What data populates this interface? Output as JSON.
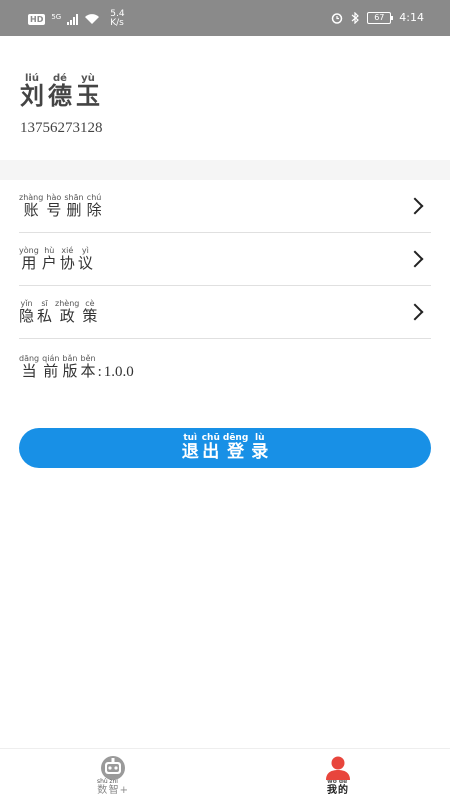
{
  "status_bar": {
    "hd": "HD",
    "network": "5G",
    "speed_value": "5.4",
    "speed_unit": "K/s",
    "battery": "67",
    "time": "4:14"
  },
  "profile": {
    "name": [
      {
        "hz": "刘",
        "py": "liú"
      },
      {
        "hz": "德",
        "py": "dé"
      },
      {
        "hz": "玉",
        "py": "yù"
      }
    ],
    "phone": "13756273128"
  },
  "menu": {
    "items": [
      {
        "chars": [
          {
            "hz": "账",
            "py": "zhàng"
          },
          {
            "hz": "号",
            "py": "hào"
          },
          {
            "hz": "删",
            "py": "shān"
          },
          {
            "hz": "除",
            "py": "chú"
          }
        ]
      },
      {
        "chars": [
          {
            "hz": "用",
            "py": "yòng"
          },
          {
            "hz": "户",
            "py": "hù"
          },
          {
            "hz": "协",
            "py": "xié"
          },
          {
            "hz": "议",
            "py": "yì"
          }
        ]
      },
      {
        "chars": [
          {
            "hz": "隐",
            "py": "yǐn"
          },
          {
            "hz": "私",
            "py": "sī"
          },
          {
            "hz": "政",
            "py": "zhèng"
          },
          {
            "hz": "策",
            "py": "cè"
          }
        ]
      }
    ],
    "version_label": [
      {
        "hz": "当",
        "py": "dāng"
      },
      {
        "hz": "前",
        "py": "qián"
      },
      {
        "hz": "版",
        "py": "bǎn"
      },
      {
        "hz": "本",
        "py": "běn"
      }
    ],
    "version_sep": ":",
    "version_value": "1.0.0"
  },
  "logout": {
    "chars": [
      {
        "hz": "退",
        "py": "tuì"
      },
      {
        "hz": "出",
        "py": "chū"
      },
      {
        "hz": "登",
        "py": "dēng"
      },
      {
        "hz": "录",
        "py": "lù"
      }
    ]
  },
  "bottom_nav": {
    "left": {
      "chars": [
        {
          "hz": "数",
          "py": "shù"
        },
        {
          "hz": "智",
          "py": "zhì"
        }
      ],
      "suffix": "+",
      "icon": "robot-icon",
      "active": false
    },
    "right": {
      "chars": [
        {
          "hz": "我",
          "py": "wǒ"
        },
        {
          "hz": "的",
          "py": "de"
        }
      ],
      "icon": "user-icon",
      "active": true
    }
  },
  "colors": {
    "accent": "#1890e6",
    "active_icon": "#e8453c",
    "inactive_icon": "#9a9a9a",
    "status_bar": "#8a8a8a"
  }
}
